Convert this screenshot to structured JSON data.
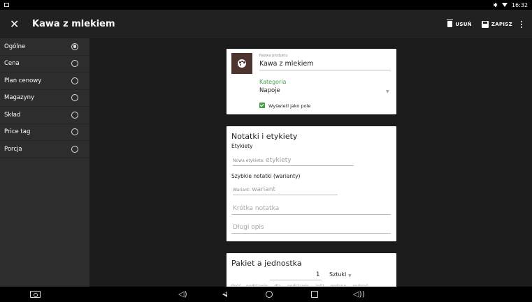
{
  "status_bar": {
    "time": "16:32",
    "bluetooth_icon": "bluetooth-icon",
    "wifi_icon": "wifi-icon",
    "notification_icon": "screenshot-notification-icon"
  },
  "toolbar": {
    "title": "Kawa z mlekiem",
    "delete_label": "USUŃ",
    "save_label": "ZAPISZ",
    "close_glyph": "✕"
  },
  "sidebar": {
    "items": [
      {
        "label": "Ogólne",
        "selected": true
      },
      {
        "label": "Cena",
        "selected": false
      },
      {
        "label": "Plan cenowy",
        "selected": false
      },
      {
        "label": "Magazyny",
        "selected": false
      },
      {
        "label": "Skład",
        "selected": false
      },
      {
        "label": "Price tag",
        "selected": false
      },
      {
        "label": "Porcja",
        "selected": false
      }
    ]
  },
  "product_card": {
    "name_label": "Nazwa produktu",
    "name_value": "Kawa z mlekiem",
    "category_label": "Kategoria",
    "category_value": "Napoje",
    "show_as_field_label": "Wyświetl jako pole",
    "show_as_field_checked": true,
    "icon_color": "#4e342e"
  },
  "notes_card": {
    "title": "Notatki i etykiety",
    "tags_heading": "Etykiety",
    "new_tag_label": "Nowa etykieta:",
    "new_tag_placeholder": "etykiety",
    "quick_notes_heading": "Szybkie notatki (warianty)",
    "variant_label": "Wariant:",
    "variant_placeholder": "wariant",
    "short_note_placeholder": "Krótka notatka",
    "long_desc_placeholder": "Długi opis"
  },
  "package_card": {
    "title": "Pakiet a jednostka",
    "quantity": "1",
    "unit": "Sztuki",
    "cut_text": "Ilość... podstawie ... dla ... podstawie ... jeśli ... podane ... wybrać ..."
  },
  "colors": {
    "accent_green": "#43a047",
    "toolbar_bg": "#212121",
    "sidebar_bg": "#2d2d2d"
  }
}
